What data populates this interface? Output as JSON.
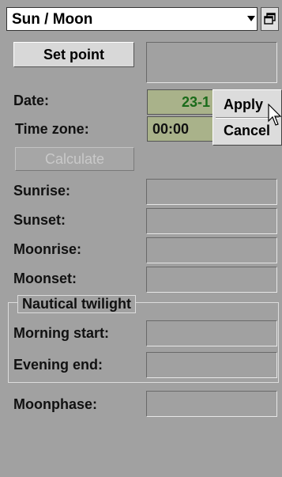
{
  "window": {
    "title": "Sun / Moon",
    "restore_icon": "restore-window-icon"
  },
  "set_point": {
    "label": "Set point"
  },
  "date": {
    "label": "Date:",
    "value": "23-1"
  },
  "time_zone": {
    "label": "Time zone:",
    "value": "00:00"
  },
  "calculate": {
    "label": "Calculate"
  },
  "results": {
    "sunrise": {
      "label": "Sunrise:"
    },
    "sunset": {
      "label": "Sunset:"
    },
    "moonrise": {
      "label": "Moonrise:"
    },
    "moonset": {
      "label": "Moonset:"
    }
  },
  "nautical_twilight": {
    "title": "Nautical twilight",
    "morning_start": {
      "label": "Morning start:"
    },
    "evening_end": {
      "label": "Evening end:"
    }
  },
  "moonphase": {
    "label": "Moonphase:"
  },
  "context_menu": {
    "items": [
      {
        "label": "Apply"
      },
      {
        "label": "Cancel"
      }
    ]
  },
  "colors": {
    "panel": "#a1a1a1",
    "date_text": "#1a6b1a",
    "input_bg": "#a9b28a"
  }
}
